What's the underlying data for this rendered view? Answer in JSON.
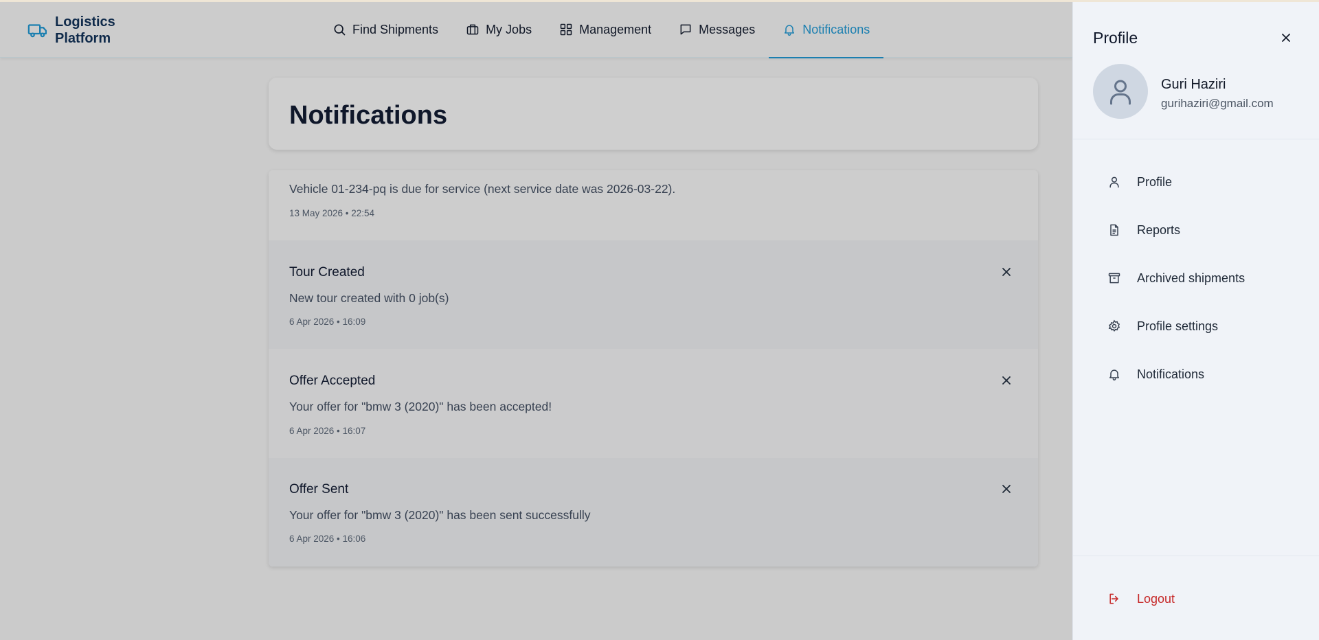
{
  "header": {
    "brand": "Logistics Platform",
    "nav": [
      {
        "label": "Find Shipments",
        "icon": "search-icon"
      },
      {
        "label": "My Jobs",
        "icon": "briefcase-icon"
      },
      {
        "label": "Management",
        "icon": "grid-icon"
      },
      {
        "label": "Messages",
        "icon": "message-icon"
      },
      {
        "label": "Notifications",
        "icon": "bell-icon",
        "active": true
      }
    ]
  },
  "main": {
    "title": "Notifications",
    "notifications": [
      {
        "title": "",
        "message": "Vehicle 01-234-pq is due for service (next service date was 2026-03-22).",
        "time": "13 May 2026 • 22:54"
      },
      {
        "title": "Tour Created",
        "message": "New tour created with 0 job(s)",
        "time": "6 Apr 2026 • 16:09"
      },
      {
        "title": "Offer Accepted",
        "message": "Your offer for \"bmw 3 (2020)\" has been accepted!",
        "time": "6 Apr 2026 • 16:07"
      },
      {
        "title": "Offer Sent",
        "message": "Your offer for \"bmw 3 (2020)\" has been sent successfully",
        "time": "6 Apr 2026 • 16:06"
      }
    ]
  },
  "drawer": {
    "title": "Profile",
    "user": {
      "name": "Guri Haziri",
      "email": "gurihaziri@gmail.com"
    },
    "menu": [
      {
        "label": "Profile",
        "icon": "user-icon"
      },
      {
        "label": "Reports",
        "icon": "document-icon"
      },
      {
        "label": "Archived shipments",
        "icon": "archive-icon"
      },
      {
        "label": "Profile settings",
        "icon": "gear-icon"
      },
      {
        "label": "Notifications",
        "icon": "bell-icon"
      }
    ],
    "logout": "Logout"
  },
  "colors": {
    "accent": "#1b7fb0",
    "logout": "#c62828",
    "brand": "#0f2a4a"
  }
}
